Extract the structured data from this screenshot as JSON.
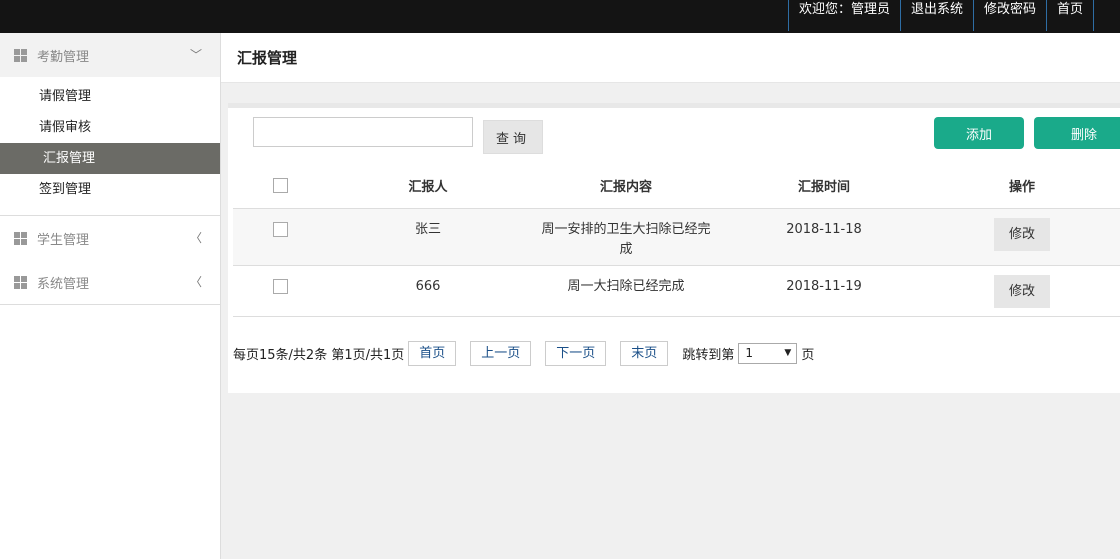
{
  "topnav": {
    "welcome": "欢迎您：管理员",
    "logout": "退出系统",
    "change_password": "修改密码",
    "home": "首页"
  },
  "sidebar": {
    "groups": [
      {
        "label": "考勤管理",
        "expanded": true,
        "items": [
          {
            "label": "请假管理",
            "active": false
          },
          {
            "label": "请假审核",
            "active": false
          },
          {
            "label": "汇报管理",
            "active": true
          },
          {
            "label": "签到管理",
            "active": false
          }
        ]
      },
      {
        "label": "学生管理",
        "expanded": false
      },
      {
        "label": "系统管理",
        "expanded": false
      }
    ]
  },
  "page": {
    "title": "汇报管理"
  },
  "toolbar": {
    "search_value": "",
    "search_button": "查询",
    "add_button": "添加",
    "delete_button": "删除"
  },
  "table": {
    "columns": [
      "汇报人",
      "汇报内容",
      "汇报时间",
      "操作"
    ],
    "rows": [
      {
        "reporter": "张三",
        "content": "周一安排的卫生大扫除已经完成",
        "time": "2018-11-18",
        "action": "修改"
      },
      {
        "reporter": "666",
        "content": "周一大扫除已经完成",
        "time": "2018-11-19",
        "action": "修改"
      }
    ]
  },
  "pager": {
    "summary": "每页15条/共2条 第1页/共1页",
    "first": "首页",
    "prev": "上一页",
    "next": "下一页",
    "last": "末页",
    "jump_prefix": "跳转到第",
    "jump_value": "1",
    "jump_suffix": "页"
  },
  "colors": {
    "topbar": "#141414",
    "accent": "#1aaa8a",
    "active_item": "#6b6b66",
    "link": "#1a4f88"
  }
}
